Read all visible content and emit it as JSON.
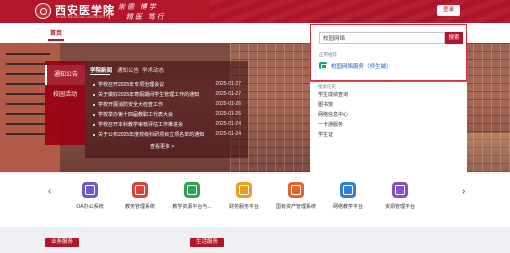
{
  "header": {
    "logo_name": "西安医学院",
    "logo_en": "XI'AN MEDICAL UNIVERSITY",
    "motto_line1": "崇德 博学",
    "motto_line2": "精医 笃行",
    "login_label": "登录"
  },
  "nav": {
    "home": "首页"
  },
  "news": {
    "side_tabs": [
      "通知公告",
      "校园活动"
    ],
    "top_tabs": [
      "学院新闻",
      "通知公告",
      "学术动态"
    ],
    "items": [
      {
        "title": "学校召开2025年专项治理会议",
        "date": "2025-01-27"
      },
      {
        "title": "关于做好2025年寒假期间学生管理工作的通知",
        "date": "2025-01-27"
      },
      {
        "title": "学校开展消防安全大检查工作",
        "date": "2025-01-26"
      },
      {
        "title": "学校举办第十四届教职工代表大会",
        "date": "2025-01-25"
      },
      {
        "title": "学校召开本科教学审核评估工作推进会",
        "date": "2025-01-24"
      },
      {
        "title": "关于公布2025年度校级科研项目立项名单的通知",
        "date": "2025-01-24"
      }
    ],
    "more": "查看更多 >"
  },
  "search": {
    "value": "校园网络",
    "button": "搜索",
    "dropdown_head": "应用推荐",
    "suggestion": "校园网络服务（师生端）"
  },
  "dropdown_list": {
    "head": "搜索历史",
    "entries": [
      "学生成绩查询",
      "图书馆",
      "网络信息中心",
      "一卡通服务",
      "学生证"
    ]
  },
  "services": [
    {
      "label": "OA办公系统",
      "color": "#6a5acd"
    },
    {
      "label": "教务管理系统",
      "color": "#d9433b"
    },
    {
      "label": "教学资源平台与...",
      "color": "#2fa34f"
    },
    {
      "label": "财务服务平台",
      "color": "#e8a020"
    },
    {
      "label": "国有资产管理系统",
      "color": "#e0652a"
    },
    {
      "label": "网络教学平台",
      "color": "#2f7fd6"
    },
    {
      "label": "资源管理平台",
      "color": "#8a4fc6"
    }
  ],
  "sections": {
    "business": "业务服务",
    "life": "生活服务"
  }
}
